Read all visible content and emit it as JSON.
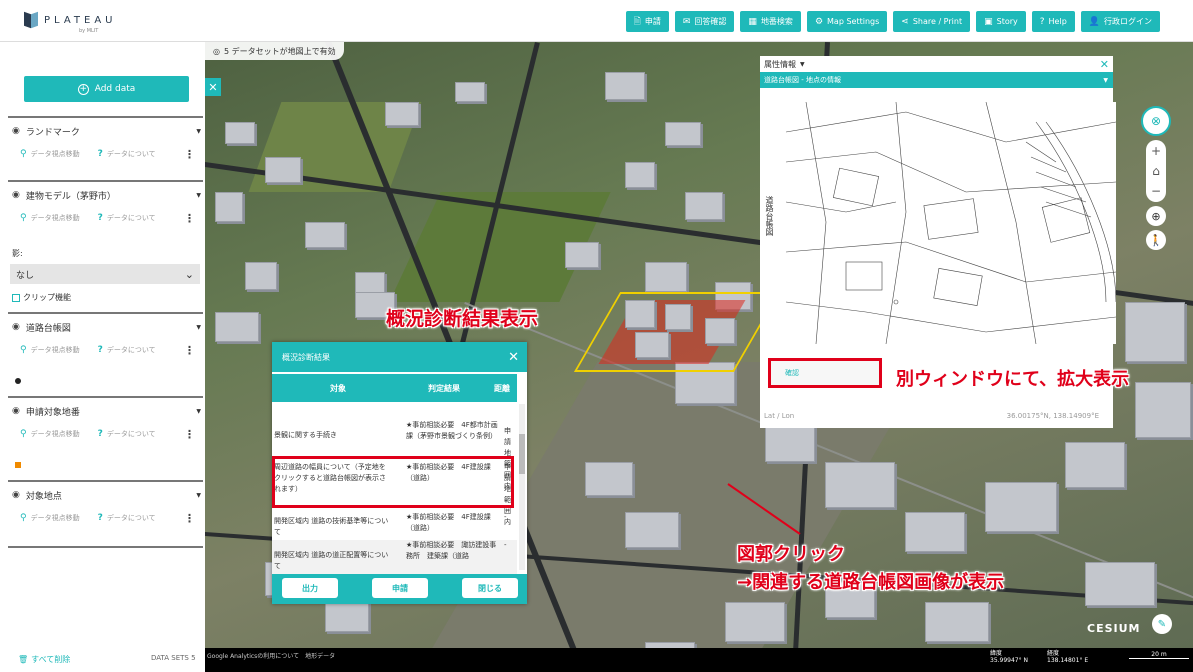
{
  "app": {
    "logo_text": "PLATEAU",
    "logo_sub": "by MLIT"
  },
  "toolbar": [
    {
      "icon": "file-icon",
      "glyph": "🗎",
      "label": "申請"
    },
    {
      "icon": "comment-icon",
      "glyph": "✉",
      "label": "回答確認"
    },
    {
      "icon": "map-search-icon",
      "glyph": "▦",
      "label": "地番検索"
    },
    {
      "icon": "settings-icon",
      "glyph": "⚙",
      "label": "Map Settings"
    },
    {
      "icon": "share-icon",
      "glyph": "⋖",
      "label": "Share / Print"
    },
    {
      "icon": "story-icon",
      "glyph": "▣",
      "label": "Story"
    },
    {
      "icon": "help-icon",
      "glyph": "?",
      "label": "Help"
    },
    {
      "icon": "user-icon",
      "glyph": "👤",
      "label": "行政ログイン"
    }
  ],
  "sidebar": {
    "add_data": "Add data",
    "layers": [
      {
        "name": "ランドマーク",
        "link1": "データ視点移動",
        "link2": "データについて"
      },
      {
        "name": "建物モデル（茅野市）",
        "link1": "データ視点移動",
        "link2": "データについて"
      },
      {
        "name": "道路台帳図",
        "link1": "データ視点移動",
        "link2": "データについて"
      },
      {
        "name": "申請対象地番",
        "link1": "データ視点移動",
        "link2": "データについて"
      },
      {
        "name": "対象地点",
        "link1": "データ視点移動",
        "link2": "データについて"
      }
    ],
    "shadow_label": "影:",
    "shadow_value": "なし",
    "clip_label": "クリップ機能",
    "delete_all": "すべて削除",
    "datasets": "DATA SETS 5"
  },
  "map": {
    "dataset_pill": "5 データセットが地図上で有効",
    "bottom_left": "Google Analyticsの利用について　地形データ",
    "lat_label": "緯度",
    "lat_value": "35.99947° N",
    "lon_label": "経度",
    "lon_value": "138.14801° E",
    "scale": "20 m",
    "cesium": "CESIUM"
  },
  "attr_panel": {
    "title": "属性情報",
    "subtitle": "道路台帳図 - 地点の情報",
    "vertical_label": "道路台帳図",
    "confirm": "確認",
    "latlon_label": "Lat / Lon",
    "latlon_value": "36.00175°N, 138.14909°E"
  },
  "diag": {
    "title": "概況診断結果",
    "col_target": "対象",
    "col_result": "判定結果",
    "col_distance": "距離",
    "rows": [
      {
        "target": "景観に関する手続き",
        "result": "★事前相談必要　4F都市計画課（茅野市景観づくり条例）",
        "dist": "申請地範囲内"
      },
      {
        "target": "周辺道路の幅員について（予定地をクリックすると道路台帳図が表示されます）",
        "result": "★事前相談必要　4F建設課（道路）",
        "dist": "申請地範囲内"
      },
      {
        "target": "開発区域内 道路の技術基準等について",
        "result": "★事前相談必要　4F建設課（道路）",
        "dist": "-"
      },
      {
        "target": "開発区域内 道路の道正配置等について",
        "result": "★事前相談必要　諏訪建設事務所　建築課（道路",
        "dist": "-"
      }
    ],
    "btn_output": "出力",
    "btn_apply": "申請",
    "btn_close": "閉じる"
  },
  "annotations": {
    "diagnosis": "概況診断結果表示",
    "separate_window": "別ウィンドウにて、拡大表示",
    "click_line1": "図郭クリック",
    "click_line2": "→関連する道路台帳図画像が表示"
  },
  "colors": {
    "accent": "#1fb9b9",
    "annotation": "#e0001a"
  }
}
